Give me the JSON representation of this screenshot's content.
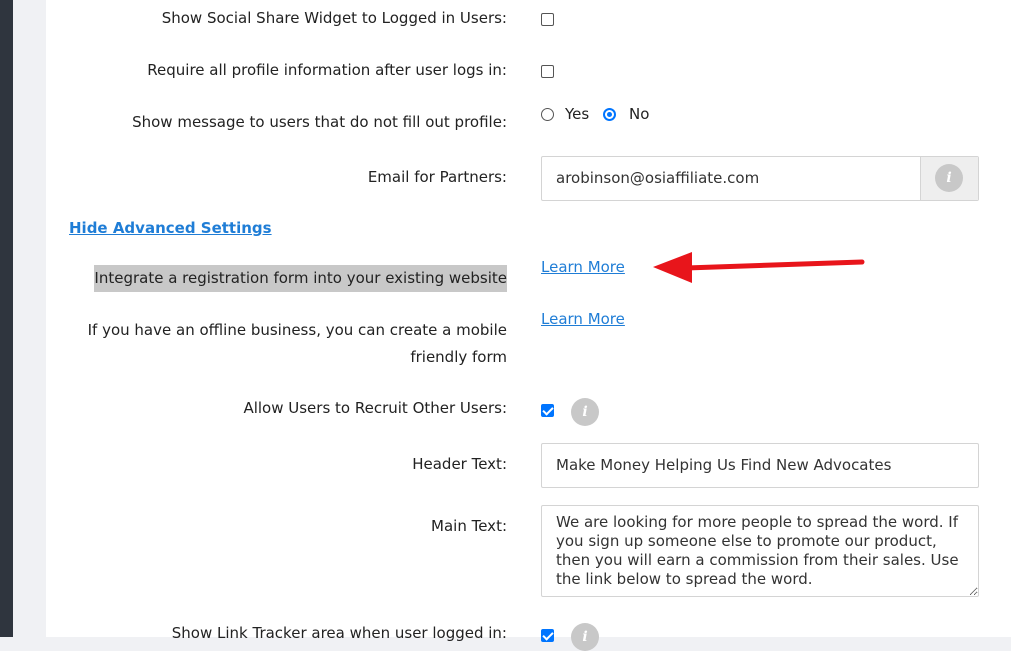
{
  "settings": {
    "social_share_label": "Show Social Share Widget to Logged in Users:",
    "require_profile_label": "Require all profile information after user logs in:",
    "show_message_label": "Show message to users that do not fill out profile:",
    "yes_label": "Yes",
    "no_label": "No",
    "email_label": "Email for Partners:",
    "email_value": "arobinson@osiaffiliate.com",
    "hide_advanced_link": "Hide Advanced Settings",
    "integrate_text": "Integrate a registration form into your existing website",
    "learn_more_1": "Learn More",
    "offline_text_line1": "If you have an offline business, you can create a mobile",
    "offline_text_line2": "friendly form",
    "learn_more_2": "Learn More",
    "recruit_label": "Allow Users to Recruit Other Users:",
    "header_text_label": "Header Text:",
    "header_text_value": "Make Money Helping Us Find New Advocates",
    "main_text_label": "Main Text:",
    "main_text_value": "We are looking for more people to spread the word. If you sign up someone else to promote our product, then you will earn a commission from their sales. Use the link below to spread the word.",
    "link_tracker_label": "Show Link Tracker area when user logged in:",
    "info_glyph": "i"
  },
  "state": {
    "social_share_checked": false,
    "require_profile_checked": false,
    "show_message_selected": "No",
    "recruit_checked": true,
    "link_tracker_checked": true
  },
  "colors": {
    "link": "#1f7dd6",
    "check_accent": "#0075ff",
    "arrow": "#e8151b",
    "highlight": "#c8c8c8"
  },
  "icons": [
    "info-icon",
    "annotation-arrow"
  ]
}
